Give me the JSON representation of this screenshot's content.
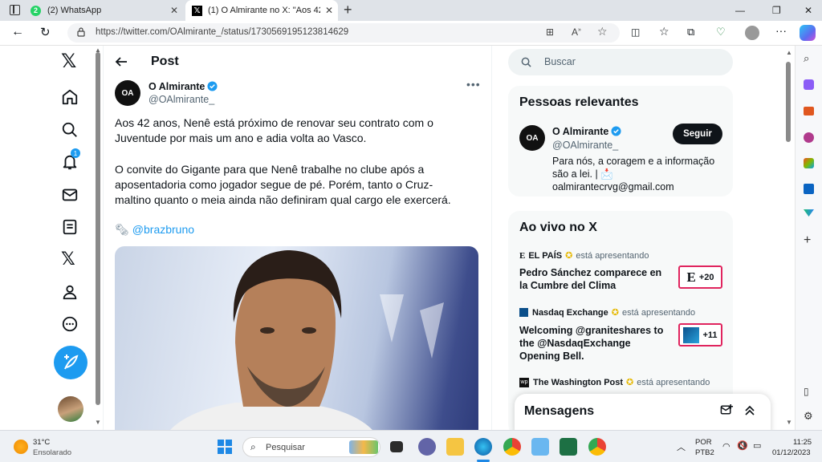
{
  "browser": {
    "tabs": [
      {
        "badge": "2",
        "title": "(2) WhatsApp"
      },
      {
        "title": "(1) O Almirante no X: \"Aos 42 an"
      }
    ],
    "new_tab_label": "+",
    "url": "https://twitter.com/OAlmirante_/status/1730569195123814629"
  },
  "x_nav": {
    "notifications_badge": "1"
  },
  "post": {
    "header_title": "Post",
    "author": {
      "name": "O Almirante",
      "handle": "@OAlmirante_",
      "avatar_text": "OA"
    },
    "paragraph1": "Aos 42 anos, Nenê está próximo de renovar seu contrato com o Juventude por mais um ano e adia volta ao Vasco.",
    "paragraph2": "O convite do Gigante para que Nenê trabalhe no clube após a aposentadoria como jogador segue de pé. Porém, tanto o Cruz-maltino quanto o meia ainda não definiram qual cargo ele exercerá.",
    "mention": "@brazbruno"
  },
  "search": {
    "placeholder": "Buscar"
  },
  "relevant": {
    "title": "Pessoas relevantes",
    "name": "O Almirante",
    "handle": "@OAlmirante_",
    "follow_label": "Seguir",
    "bio": "Para nós, a coragem e a informação são a lei. | 📩 oalmirantecrvg@gmail.com"
  },
  "live": {
    "title": "Ao vivo no X",
    "presenting_label": "está apresentando",
    "items": [
      {
        "source": "EL PAÍS",
        "logo": "E",
        "headline": "Pedro Sánchez comparece en la Cumbre del Clima",
        "count": "+20"
      },
      {
        "source": "Nasdaq Exchange",
        "logo": "N",
        "headline": "Welcoming @graniteshares to the @NasdaqExchange Opening Bell.",
        "count": "+11"
      },
      {
        "source": "The Washington Post",
        "logo": "wp"
      }
    ]
  },
  "messages": {
    "title": "Mensagens"
  },
  "taskbar": {
    "weather_temp": "31°C",
    "weather_desc": "Ensolarado",
    "search_placeholder": "Pesquisar",
    "lang": "POR",
    "layout": "PTB2",
    "time": "11:25",
    "date": "01/12/2023"
  },
  "colors": {
    "accent": "#1d9bf0",
    "live_border": "#e0245e",
    "verified": "#1d9bf0"
  }
}
